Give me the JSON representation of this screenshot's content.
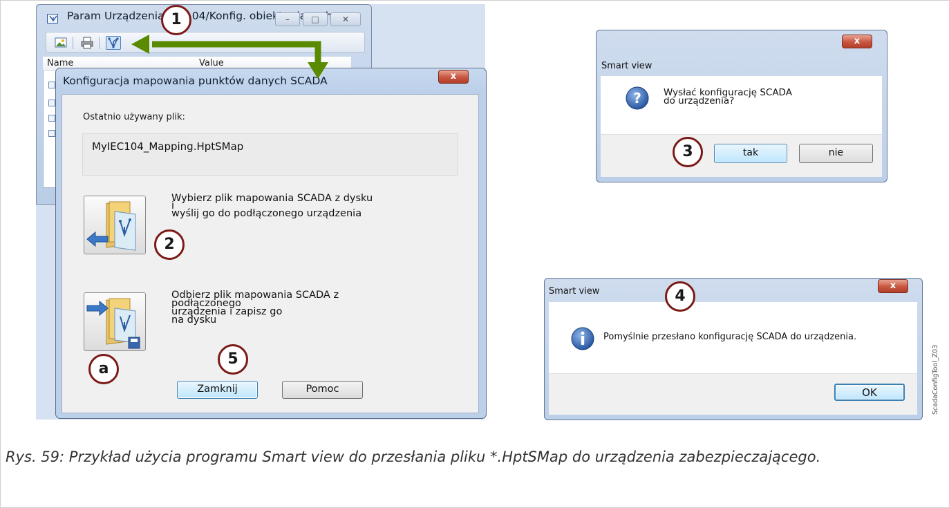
{
  "background_window": {
    "title": "Param Urządzenia/IEC104/Konfig. obiektu danych",
    "columns": [
      "Name",
      "Value"
    ]
  },
  "scada_dialog": {
    "title": "Konfiguracja mapowania punktów danych SCADA",
    "close_glyph": "x",
    "last_used_label": "Ostatnio używany plik:",
    "last_used_file": "MyIEC104_Mapping.HptSMap",
    "send_action": {
      "line1": "Wybierz plik mapowania SCADA z dysku",
      "line2": "i",
      "line3": "wyślij go do podłączonego urządzenia",
      "icon": "folder-send-icon"
    },
    "receive_action": {
      "line1": "Odbierz plik mapowania SCADA z",
      "line2": "podłączonego",
      "line3": "urządzenia i zapisz go",
      "line4": "na dysku",
      "icon": "folder-receive-save-icon"
    },
    "close_button": "Zamknij",
    "help_button": "Pomoc"
  },
  "confirm_dialog": {
    "title": "Smart view",
    "close_glyph": "x",
    "icon": "question-icon",
    "message_line1": "Wysłać konfigurację SCADA",
    "message_line2": "do urządzenia?",
    "yes_button": "tak",
    "no_button": "nie"
  },
  "success_dialog": {
    "title": "Smart view",
    "close_glyph": "x",
    "icon": "info-icon",
    "message": "Pomyślnie przesłano konfigurację SCADA do urządzenia.",
    "ok_button": "OK"
  },
  "callouts": {
    "c1": "1",
    "c2": "2",
    "c3": "3",
    "c4": "4",
    "c5": "5",
    "ca": "a"
  },
  "colors": {
    "callout_border": "#7b1a16",
    "arrow": "#5a8a00",
    "close_button_red": "#c8553f"
  },
  "caption": "Rys. 59: Przykład użycia programu Smart view do przesłania pliku *.HptSMap do urządzenia zabezpieczającego.",
  "side_label": "ScadaConfigTool_Z03"
}
